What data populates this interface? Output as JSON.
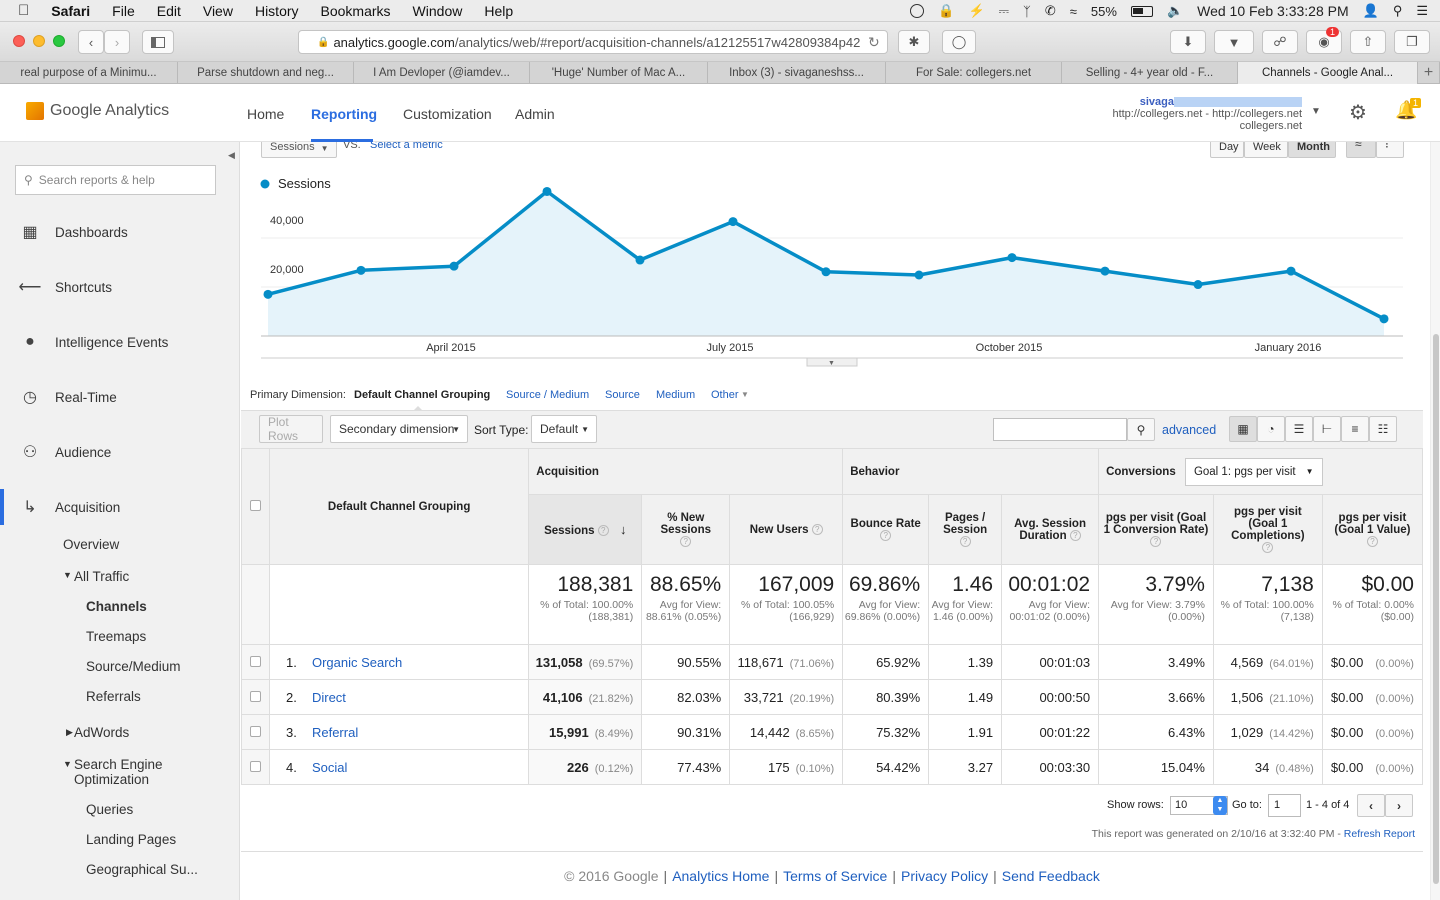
{
  "menubar": {
    "app": "Safari",
    "items": [
      "File",
      "Edit",
      "View",
      "History",
      "Bookmarks",
      "Window",
      "Help"
    ],
    "battery": "55%",
    "clock": "Wed 10 Feb  3:33:28 PM"
  },
  "browser": {
    "url_host": "analytics.google.com",
    "url_path": "/analytics/web/#report/acquisition-channels/a12125517w42809384p42",
    "tabs": [
      "real purpose of a Minimu...",
      "Parse shutdown and neg...",
      "I Am Devloper (@iamdev...",
      "'Huge' Number of Mac A...",
      "Inbox (3) - sivaganeshss...",
      "For Sale: collegers.net",
      "Selling - 4+ year old - F...",
      "Channels - Google Anal..."
    ],
    "notif_badge": "1"
  },
  "ga": {
    "logo": "Google Analytics",
    "nav": [
      "Home",
      "Reporting",
      "Customization",
      "Admin"
    ],
    "account_user": "sivaga",
    "account_property": "http://collegers.net - http://collegers.net",
    "account_view": "collegers.net",
    "bell_badge": "1"
  },
  "sidebar": {
    "search_placeholder": "Search reports & help",
    "items": [
      "Dashboards",
      "Shortcuts",
      "Intelligence Events",
      "Real-Time",
      "Audience",
      "Acquisition"
    ],
    "sub": {
      "overview": "Overview",
      "all_traffic": "All Traffic",
      "channels": "Channels",
      "treemaps": "Treemaps",
      "source_medium": "Source/Medium",
      "referrals": "Referrals",
      "adwords": "AdWords",
      "seo": "Search Engine Optimization",
      "queries": "Queries",
      "landing": "Landing Pages",
      "geo": "Geographical Su..."
    }
  },
  "chart_controls": {
    "metric": "Sessions",
    "vs": "VS.",
    "select_metric": "Select a metric",
    "periods": [
      "Day",
      "Week",
      "Month"
    ]
  },
  "chart_data": {
    "type": "area",
    "series": [
      {
        "name": "Sessions",
        "values": [
          17000,
          26800,
          28500,
          59000,
          31000,
          46700,
          26200,
          24900,
          32000,
          26500,
          21000,
          26500,
          7000
        ]
      }
    ],
    "x": [
      "Feb 2015",
      "Mar 2015",
      "Apr 2015",
      "May 2015",
      "Jun 2015",
      "Jul 2015",
      "Aug 2015",
      "Sep 2015",
      "Oct 2015",
      "Nov 2015",
      "Dec 2015",
      "Jan 2016",
      "Feb 2016"
    ],
    "x_tick_labels": [
      "April 2015",
      "July 2015",
      "October 2015",
      "January 2016"
    ],
    "y_tick_labels": [
      "40,000",
      "20,000"
    ],
    "ylim": [
      0,
      80000
    ],
    "color": "#058dc7"
  },
  "dimension_bar": {
    "label": "Primary Dimension:",
    "active": "Default Channel Grouping",
    "options": [
      "Source / Medium",
      "Source",
      "Medium",
      "Other"
    ]
  },
  "table_controls": {
    "plot_rows": "Plot Rows",
    "secondary": "Secondary dimension",
    "sort_label": "Sort Type:",
    "sort_value": "Default",
    "advanced": "advanced"
  },
  "table": {
    "dim_header": "Default Channel Grouping",
    "groups": [
      "Acquisition",
      "Behavior",
      "Conversions"
    ],
    "goal_select": "Goal 1: pgs per visit",
    "columns": [
      "Sessions",
      "% New Sessions",
      "New Users",
      "Bounce Rate",
      "Pages / Session",
      "Avg. Session Duration",
      "pgs per visit (Goal 1 Conversion Rate)",
      "pgs per visit (Goal 1 Completions)",
      "pgs per visit (Goal 1 Value)"
    ],
    "totals": [
      {
        "v": "188,381",
        "s": "% of Total: 100.00% (188,381)"
      },
      {
        "v": "88.65%",
        "s": "Avg for View: 88.61% (0.05%)"
      },
      {
        "v": "167,009",
        "s": "% of Total: 100.05% (166,929)"
      },
      {
        "v": "69.86%",
        "s": "Avg for View: 69.86% (0.00%)"
      },
      {
        "v": "1.46",
        "s": "Avg for View: 1.46 (0.00%)"
      },
      {
        "v": "00:01:02",
        "s": "Avg for View: 00:01:02 (0.00%)"
      },
      {
        "v": "3.79%",
        "s": "Avg for View: 3.79% (0.00%)"
      },
      {
        "v": "7,138",
        "s": "% of Total: 100.00% (7,138)"
      },
      {
        "v": "$0.00",
        "s": "% of Total: 0.00% ($0.00)"
      }
    ],
    "rows": [
      {
        "n": "1.",
        "name": "Organic Search",
        "sessions": "131,058",
        "sessions_pct": "(69.57%)",
        "new_sess": "90.55%",
        "new_users": "118,671",
        "new_users_pct": "(71.06%)",
        "bounce": "65.92%",
        "pages": "1.39",
        "duration": "00:01:03",
        "conv": "3.49%",
        "compl": "4,569",
        "compl_pct": "(64.01%)",
        "value": "$0.00",
        "value_pct": "(0.00%)"
      },
      {
        "n": "2.",
        "name": "Direct",
        "sessions": "41,106",
        "sessions_pct": "(21.82%)",
        "new_sess": "82.03%",
        "new_users": "33,721",
        "new_users_pct": "(20.19%)",
        "bounce": "80.39%",
        "pages": "1.49",
        "duration": "00:00:50",
        "conv": "3.66%",
        "compl": "1,506",
        "compl_pct": "(21.10%)",
        "value": "$0.00",
        "value_pct": "(0.00%)"
      },
      {
        "n": "3.",
        "name": "Referral",
        "sessions": "15,991",
        "sessions_pct": "(8.49%)",
        "new_sess": "90.31%",
        "new_users": "14,442",
        "new_users_pct": "(8.65%)",
        "bounce": "75.32%",
        "pages": "1.91",
        "duration": "00:01:22",
        "conv": "6.43%",
        "compl": "1,029",
        "compl_pct": "(14.42%)",
        "value": "$0.00",
        "value_pct": "(0.00%)"
      },
      {
        "n": "4.",
        "name": "Social",
        "sessions": "226",
        "sessions_pct": "(0.12%)",
        "new_sess": "77.43%",
        "new_users": "175",
        "new_users_pct": "(0.10%)",
        "bounce": "54.42%",
        "pages": "3.27",
        "duration": "00:03:30",
        "conv": "15.04%",
        "compl": "34",
        "compl_pct": "(0.48%)",
        "value": "$0.00",
        "value_pct": "(0.00%)"
      }
    ]
  },
  "pagination": {
    "show_rows_label": "Show rows:",
    "show_rows_value": "10",
    "goto_label": "Go to:",
    "goto_value": "1",
    "range": "1 - 4 of 4",
    "generated": "This report was generated on 2/10/16 at 3:32:40 PM -",
    "refresh": "Refresh Report"
  },
  "footer": {
    "copyright": "© 2016 Google",
    "links": [
      "Analytics Home",
      "Terms of Service",
      "Privacy Policy",
      "Send Feedback"
    ]
  }
}
